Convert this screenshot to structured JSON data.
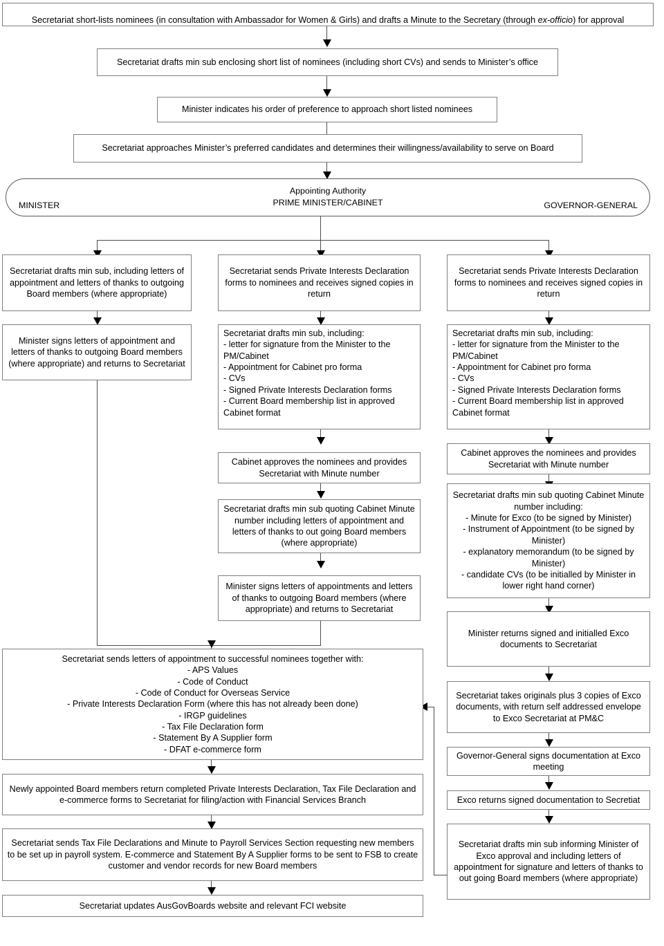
{
  "diagram": {
    "title": "Board appointment process flowchart",
    "colors": {
      "box_border": "#7f7f7f",
      "connector": "#4d4d4d",
      "arrow": "#000000",
      "background": "#ffffff"
    }
  },
  "nodes": {
    "n1": "Secretariat short-lists nominees (in consultation with Ambassador for Women & Girls) and drafts a Minute to the Secretary (through ex-officio) for approval",
    "n1_pre": "Secretariat short-lists nominees (in consultation with Ambassador for Women & Girls) and drafts a Minute to the Secretary (through ",
    "n1_italic": "ex-officio",
    "n1_post": ") for approval",
    "n2": "Secretariat drafts min sub enclosing short list of nominees (including short CVs) and sends to Minister’s office",
    "n3": "Minister indicates his order of preference to approach short listed nominees",
    "n4": "Secretariat approaches Minister’s preferred candidates and determines their willingness/availability to serve on Board"
  },
  "authority": {
    "left_label": "MINISTER",
    "center_label": "Appointing Authority\nPRIME MINISTER/CABINET",
    "right_label": "GOVERNOR-GENERAL"
  },
  "minister_column": [
    "Secretariat drafts min sub, including letters of appointment and letters of thanks to outgoing Board members (where appropriate)",
    "Minister signs letters of appointment and letters of thanks to outgoing Board members (where appropriate) and returns to Secretariat"
  ],
  "cabinet_column": [
    "Secretariat sends Private Interests Declaration forms to nominees and receives signed copies in return",
    "Secretariat drafts min sub, including:\n- letter for signature from the Minister to the PM/Cabinet\n- Appointment for Cabinet pro forma\n- CVs\n- Signed Private Interests Declaration forms\n- Current Board membership list in approved Cabinet format",
    "Cabinet approves the nominees and provides Secretariat with Minute number",
    "Secretariat drafts min sub quoting Cabinet Minute number including letters of appointment and letters of thanks to out going Board members (where appropriate)",
    "Minister signs letters of appointments and letters of thanks to outgoing Board members (where appropriate) and returns to Secretariat"
  ],
  "gg_column": [
    "Secretariat sends Private Interests Declaration forms to nominees and receives signed copies in return",
    "Secretariat drafts min sub, including:\n- letter for signature from the Minister to the PM/Cabinet\n- Appointment for Cabinet pro forma\n- CVs\n- Signed Private Interests Declaration forms\n- Current Board membership list in approved Cabinet format",
    "Cabinet approves the nominees and provides Secretariat with Minute number",
    "Secretariat drafts min sub quoting Cabinet Minute number including:\n- Minute for Exco (to be signed by Minister)\n- Instrument of Appointment (to be signed by Minister)\n- explanatory memorandum (to be signed by Minister)\n- candidate CVs (to be initialled by Minister in lower right hand corner)",
    "Minister returns signed and initialled Exco documents to Secretariat",
    "Secretariat takes originals plus 3 copies of Exco documents, with return self addressed envelope to Exco Secretariat at PM&C",
    "Governor-General signs documentation at Exco meeting",
    "Exco returns signed documentation to Secretiat",
    "Secretariat drafts min sub informing Minister of Exco approval and including letters of appointment for signature and letters of thanks to out going Board members (where appropriate)"
  ],
  "common_tail": [
    "Secretariat sends letters of appointment to successful nominees together with:\n- APS Values\n- Code of Conduct\n- Code of Conduct for Overseas Service\n- Private Interests Declaration Form (where this has not already been done)\n- IRGP guidelines\n- Tax File Declaration form\n- Statement By A Supplier form\n- DFAT e-commerce form",
    "Newly appointed Board members return completed Private Interests Declaration, Tax File Declaration and e-commerce forms to Secretariat for filing/action with Financial Services Branch",
    "Secretariat sends Tax File Declarations and Minute to Payroll Services Section requesting new members to be set up in payroll system.  E-commerce and Statement By A Supplier forms to be sent to FSB to create customer and vendor records for new Board members",
    "Secretariat updates AusGovBoards website and relevant FCI website"
  ]
}
